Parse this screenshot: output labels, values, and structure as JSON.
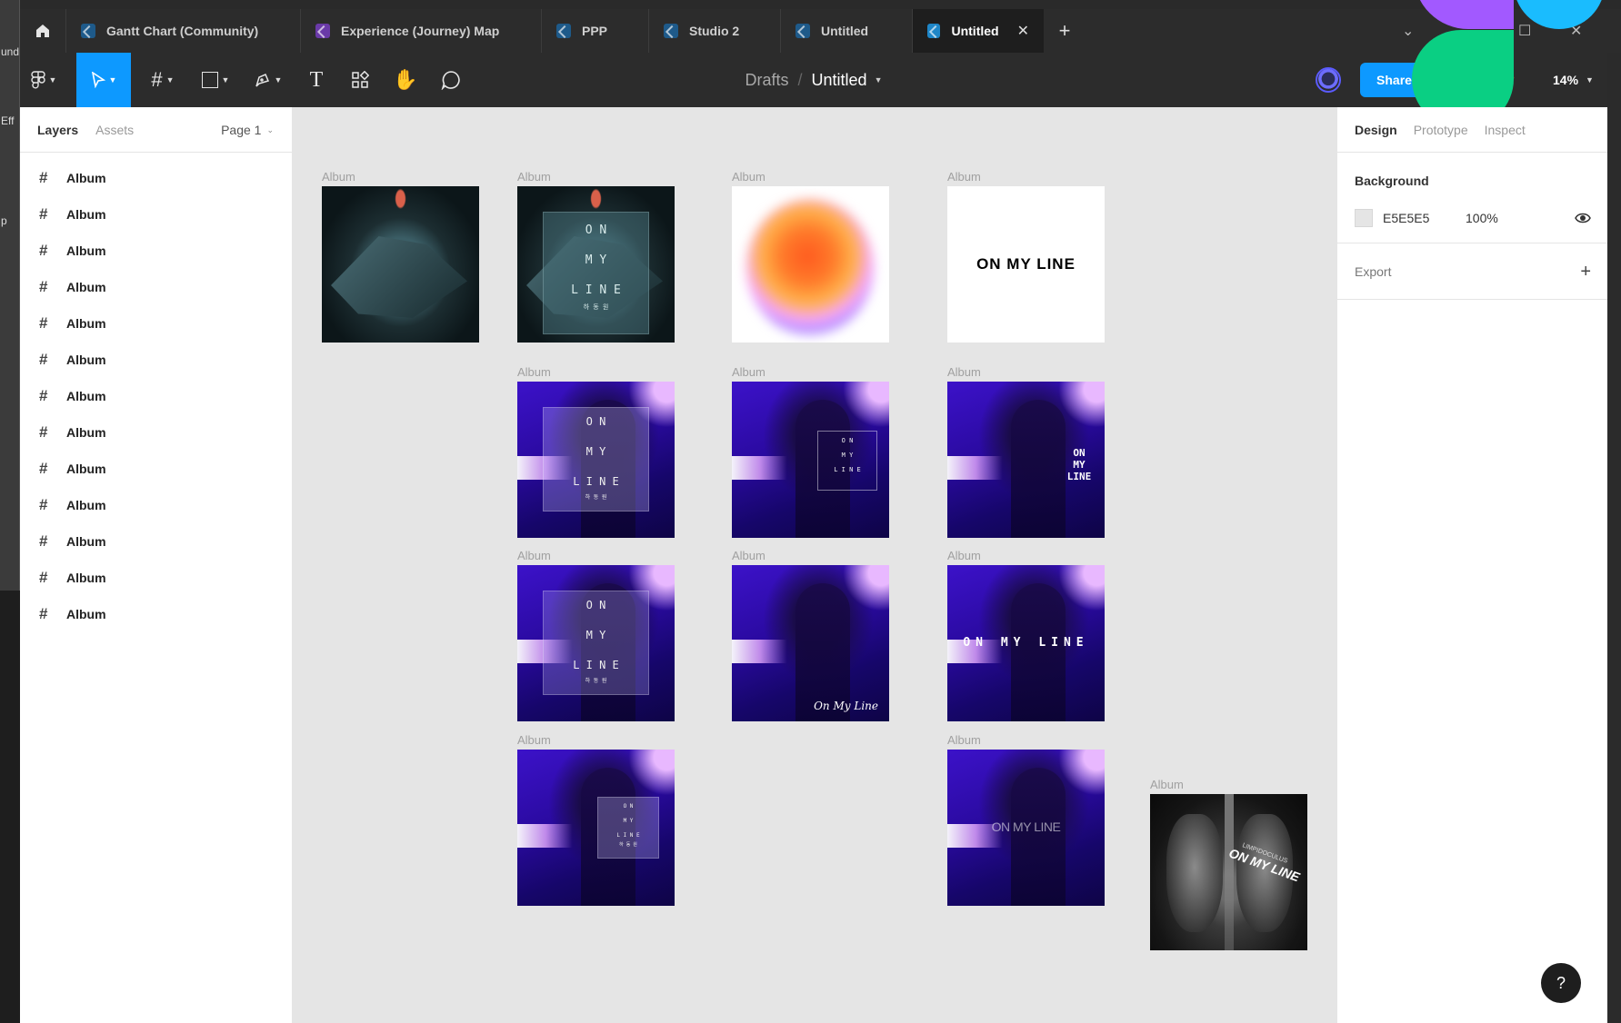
{
  "background_window": {
    "fragments": [
      "und",
      "Eff",
      "p"
    ]
  },
  "tabs": [
    {
      "label": "Gantt Chart (Community)",
      "color": "#1e5a8a"
    },
    {
      "label": "Experience (Journey) Map",
      "color": "#6a3aa8"
    },
    {
      "label": "PPP",
      "color": "#1e5a8a"
    },
    {
      "label": "Studio 2",
      "color": "#1e5a8a"
    },
    {
      "label": "Untitled",
      "color": "#1e5a8a"
    },
    {
      "label": "Untitled",
      "color": "#1e86c8",
      "active": true
    }
  ],
  "toolbar": {
    "breadcrumb_parent": "Drafts",
    "breadcrumb_separator": "/",
    "file_title": "Untitled",
    "share_label": "Share",
    "help_glyph": "?",
    "zoom_level": "14%"
  },
  "left_panel": {
    "tab_layers": "Layers",
    "tab_assets": "Assets",
    "page_selector": "Page 1",
    "layers": [
      "Album",
      "Album",
      "Album",
      "Album",
      "Album",
      "Album",
      "Album",
      "Album",
      "Album",
      "Album",
      "Album",
      "Album",
      "Album"
    ]
  },
  "canvas": {
    "background": "#E5E5E5",
    "frame_label": "Album",
    "texts": {
      "on": "O N",
      "my": "M Y",
      "line": "L I N E",
      "line_small": "L I N E",
      "sub": "하 동 원",
      "on_my_line_caps": "ON MY LINE",
      "stack_on": "ON",
      "stack_my": "MY",
      "stack_line": "LINE",
      "wide": "ON MY LINE",
      "script": "On My Line",
      "thin": "ON MY LINE",
      "xray_title": "ON MY LINE",
      "xray_sub": "LIMPIDOCULUS"
    }
  },
  "right_panel": {
    "tab_design": "Design",
    "tab_prototype": "Prototype",
    "tab_inspect": "Inspect",
    "background_heading": "Background",
    "background_hex": "E5E5E5",
    "background_opacity": "100%",
    "export_heading": "Export"
  },
  "help_button": "?",
  "colors": {
    "accent": "#0D99FF",
    "dark_ui": "#2C2C2C",
    "canvas": "#E5E5E5"
  }
}
